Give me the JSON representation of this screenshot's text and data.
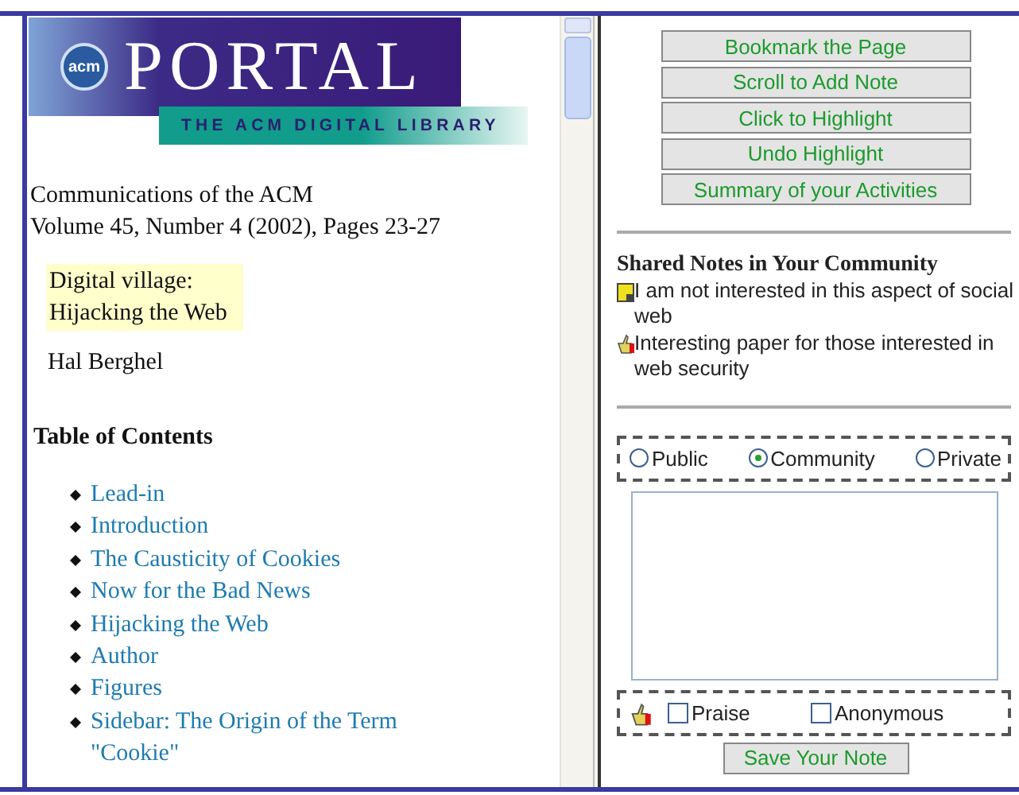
{
  "logo": {
    "badge": "acm",
    "title": "PORTAL",
    "subtitle": "THE ACM DIGITAL LIBRARY"
  },
  "article": {
    "journal": "Communications of the ACM",
    "issue": "Volume 45, Number 4 (2002), Pages 23-27",
    "title_lines": [
      "Digital village:",
      "Hijacking the Web"
    ],
    "author": "Hal Berghel"
  },
  "toc": {
    "heading": "Table of Contents",
    "items": [
      "Lead-in",
      "Introduction",
      "The Causticity of Cookies",
      "Now for the Bad News",
      "Hijacking the Web",
      "Author",
      "Figures",
      "Sidebar: The Origin of the Term \"Cookie\""
    ]
  },
  "actions": [
    "Bookmark the Page",
    "Scroll to Add Note",
    "Click to Highlight",
    "Undo Highlight",
    "Summary of your Activities"
  ],
  "shared_notes": {
    "heading": "Shared Notes in Your Community",
    "notes": [
      {
        "kind": "note",
        "text": "I am not interested in this aspect of social web"
      },
      {
        "kind": "praise",
        "text": "Interesting paper for those interested in web security"
      }
    ]
  },
  "visibility": [
    {
      "label": "Public",
      "selected": false
    },
    {
      "label": "Community",
      "selected": true
    },
    {
      "label": "Private",
      "selected": false
    }
  ],
  "options": [
    {
      "label": "Praise",
      "checked": false
    },
    {
      "label": "Anonymous",
      "checked": false
    }
  ],
  "save_button": "Save Your Note"
}
